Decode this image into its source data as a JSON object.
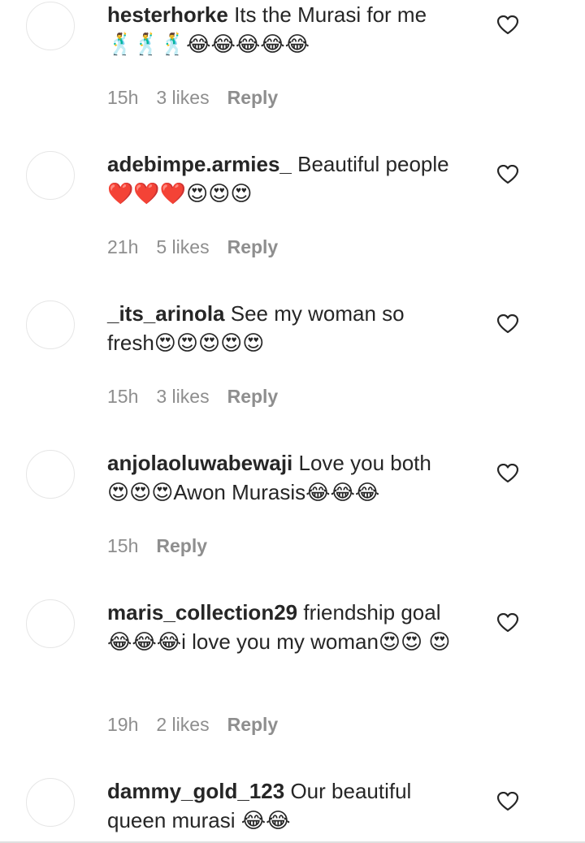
{
  "comments": [
    {
      "username": "hesterhorke",
      "text": "Its the Murasi for me\n🕺🕺🕺😂😂😂😂😂",
      "time": "15h",
      "likes": "3 likes",
      "reply": "Reply"
    },
    {
      "username": "adebimpe.armies_",
      "text": "Beautiful people\n❤️❤️❤️😍😍😍",
      "time": "21h",
      "likes": "5 likes",
      "reply": "Reply"
    },
    {
      "username": "_its_arinola",
      "text": "See my woman so fresh😍😍😍😍😍",
      "time": "15h",
      "likes": "3 likes",
      "reply": "Reply"
    },
    {
      "username": "anjolaoluwabewaji",
      "text": "Love you both 😍😍😍Awon Murasis😂😂😂",
      "time": "15h",
      "likes": "",
      "reply": "Reply"
    },
    {
      "username": "maris_collection29",
      "text": "friendship goal 😂😂😂i love you my woman😍😍 😍",
      "time": "19h",
      "likes": "2 likes",
      "reply": "Reply"
    },
    {
      "username": "dammy_gold_123",
      "text": "Our beautiful queen murasi 😂😂",
      "time": "",
      "likes": "",
      "reply": ""
    }
  ],
  "icons": {
    "like": "heart-outline-icon"
  },
  "colors": {
    "text": "#262626",
    "meta": "#8e8e8e",
    "avatar_border": "#e6e6e6"
  }
}
